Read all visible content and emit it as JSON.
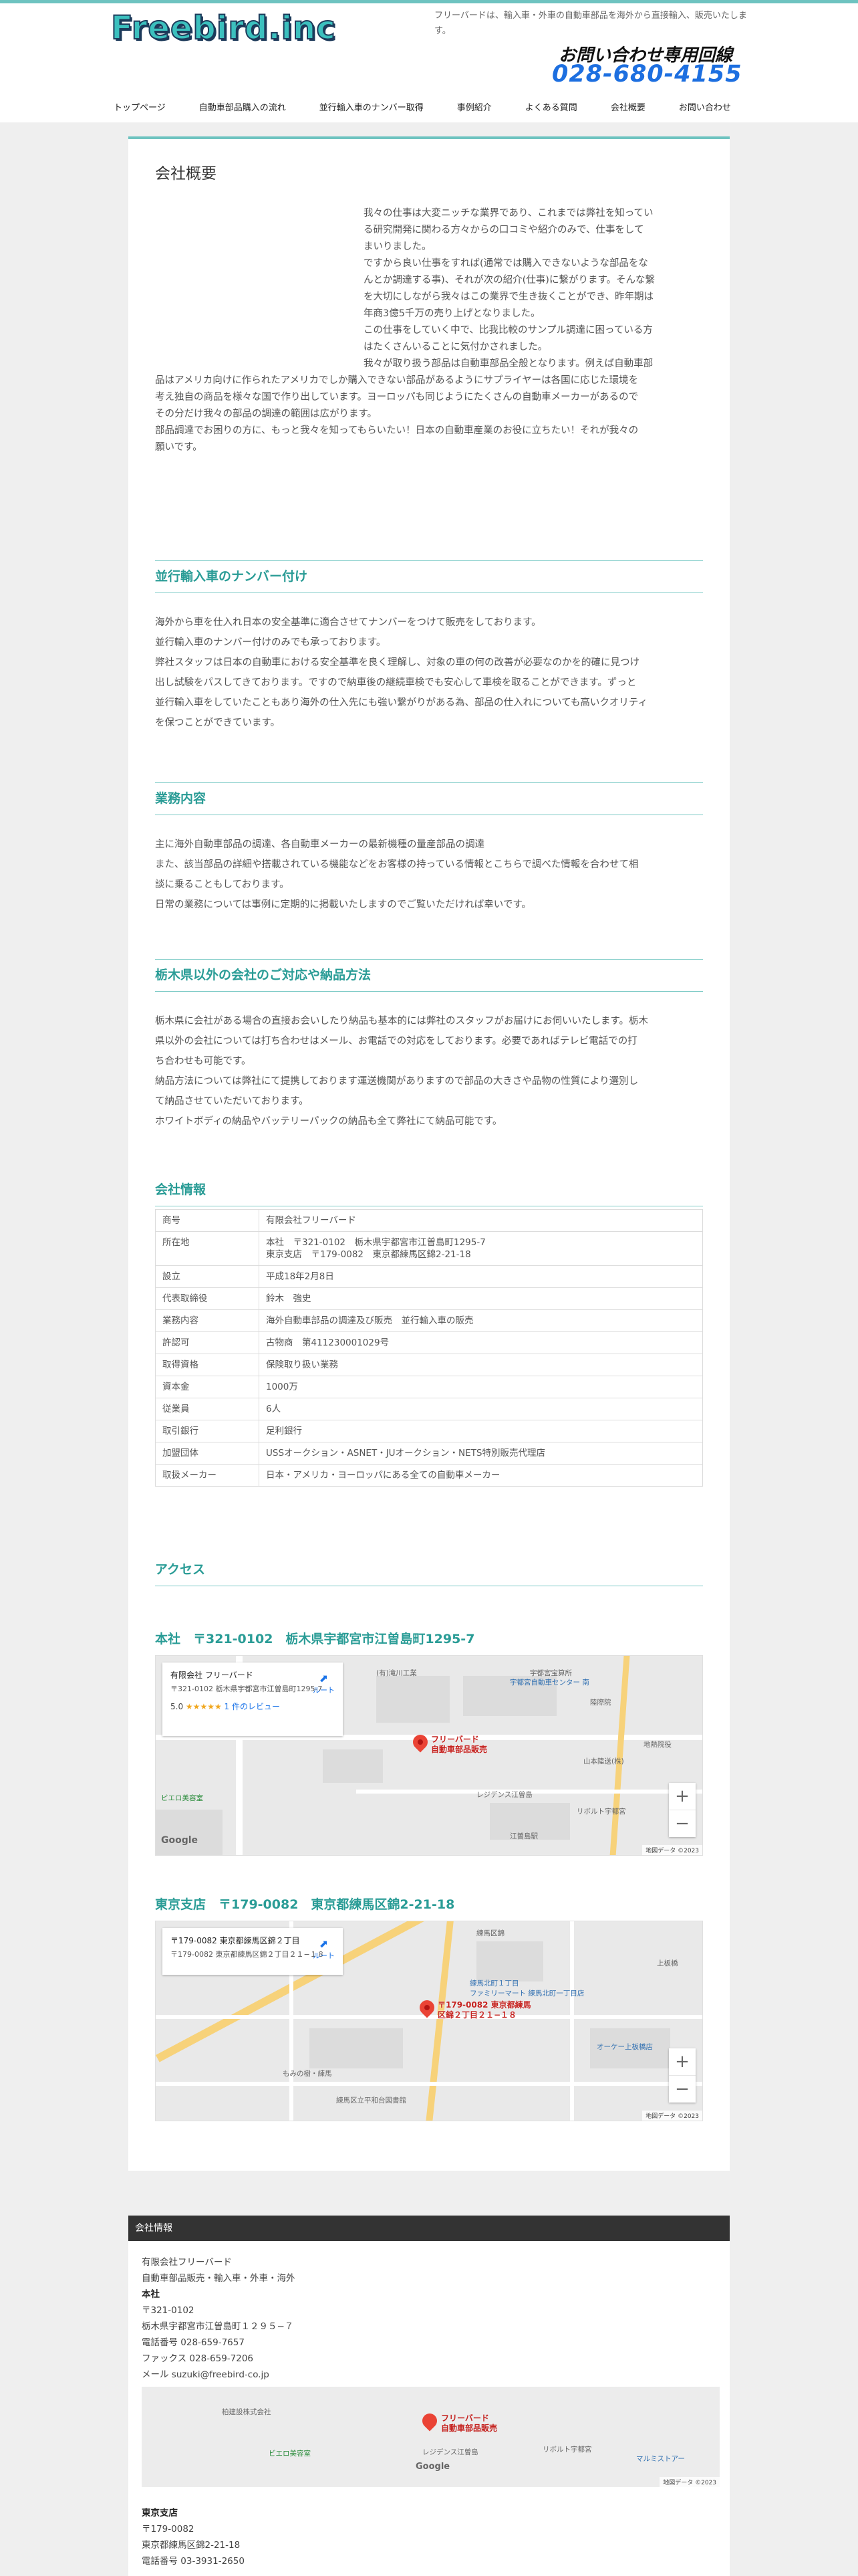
{
  "header": {
    "logo": "Freebird.inc",
    "tagline": "フリーバードは、輸入車・外車の自動車部品を海外から直接輸入、販売いたします。",
    "contact_label": "お問い合わせ専用回線",
    "contact_phone": "028-680-4155"
  },
  "nav": [
    {
      "label": "トップページ"
    },
    {
      "label": "自動車部品購入の流れ"
    },
    {
      "label": "並行輸入車のナンバー取得"
    },
    {
      "label": "事例紹介"
    },
    {
      "label": "よくある質問"
    },
    {
      "label": "会社概要"
    },
    {
      "label": "お問い合わせ"
    }
  ],
  "page": {
    "title": "会社概要",
    "intro_lines": [
      "我々の仕事は大変ニッチな業界であり、これまでは弊社を知ってい",
      "る研究開発に関わる方々からの口コミや紹介のみで、仕事をして",
      "まいりました。",
      "ですから良い仕事をすれば(通常では購入できないような部品をな",
      "んとか調達する事)、それが次の紹介(仕事)に繋がります。そんな繋",
      "を大切にしながら我々はこの業界で生き抜くことができ、昨年期は",
      "年商3億5千万の売り上げとなりました。",
      "この仕事をしていく中で、比我比較のサンプル調達に困っている方",
      "はたくさんいることに気付かされました。",
      "我々が取り扱う部品は自動車部品全般となります。例えば自動車部",
      "品はアメリカ向けに作られたアメリカでしか購入できない部品があるようにサプライヤーは各国に応じた環境を",
      "考え独自の商品を様々な国で作り出しています。ヨーロッパも同じようにたくさんの自動車メーカーがあるので",
      "その分だけ我々の部品の調達の範囲は広がります。",
      "部品調達でお困りの方に、もっと我々を知ってもらいたい！日本の自動車産業のお役に立ちたい！それが我々の",
      "願いです。"
    ]
  },
  "sections": {
    "number": {
      "title": "並行輸入車のナンバー付け",
      "lines": [
        "海外から車を仕入れ日本の安全基準に適合させてナンバーをつけて販売をしております。",
        "並行輸入車のナンバー付けのみでも承っております。",
        "弊社スタッフは日本の自動車における安全基準を良く理解し、対象の車の何の改善が必要なのかを的確に見つけ",
        "出し試験をパスしてきております。ですので納車後の継続車検でも安心して車検を取ることができます。ずっと",
        "並行輸入車をしていたこともあり海外の仕入先にも強い繋がりがある為、部品の仕入れについても高いクオリティ",
        "を保つことができています。"
      ]
    },
    "business": {
      "title": "業務内容",
      "lines": [
        "主に海外自動車部品の調達、各自動車メーカーの最新機種の量産部品の調達",
        "また、該当部品の詳細や搭載されている機能などをお客様の持っている情報とこちらで調べた情報を合わせて相",
        "談に乗ることもしております。",
        "日常の業務については事例に定期的に掲載いたしますのでご覧いただければ幸いです。"
      ]
    },
    "outside": {
      "title": "栃木県以外の会社のご対応や納品方法",
      "lines": [
        "栃木県に会社がある場合の直接お会いしたり納品も基本的には弊社のスタッフがお届けにお伺いいたします。栃木",
        "県以外の会社については打ち合わせはメール、お電話での対応をしております。必要であればテレビ電話での打",
        "ち合わせも可能です。",
        "納品方法については弊社にて提携しております運送機関がありますので部品の大きさや品物の性質により選別し",
        "て納品させていただいております。",
        "ホワイトボディの納品やバッテリーパックの納品も全て弊社にて納品可能です。"
      ]
    },
    "company_info": {
      "title": "会社情報",
      "rows": [
        {
          "k": "商号",
          "v": [
            "有限会社フリーバード"
          ]
        },
        {
          "k": "所在地",
          "v": [
            "本社　〒321-0102　栃木県宇都宮市江曽島町1295-7",
            "東京支店　〒179-0082　東京都練馬区錦2-21-18"
          ]
        },
        {
          "k": "設立",
          "v": [
            "平成18年2月8日"
          ]
        },
        {
          "k": "代表取締役",
          "v": [
            "鈴木　強史"
          ]
        },
        {
          "k": "業務内容",
          "v": [
            "海外自動車部品の調達及び販売　並行輸入車の販売"
          ]
        },
        {
          "k": "許認可",
          "v": [
            "古物商　第411230001029号"
          ]
        },
        {
          "k": "取得資格",
          "v": [
            "保険取り扱い業務"
          ]
        },
        {
          "k": "資本金",
          "v": [
            "1000万"
          ]
        },
        {
          "k": "従業員",
          "v": [
            "6人"
          ]
        },
        {
          "k": "取引銀行",
          "v": [
            "足利銀行"
          ]
        },
        {
          "k": "加盟団体",
          "v": [
            "USSオークション・ASNET・JUオークション・NETS特別販売代理店"
          ]
        },
        {
          "k": "取扱メーカー",
          "v": [
            "日本・アメリカ・ヨーロッパにある全ての自動車メーカー"
          ]
        }
      ]
    },
    "access": {
      "title": "アクセス",
      "honsha_heading": "本社　〒321-0102　栃木県宇都宮市江曽島町1295-7",
      "tokyo_heading": "東京支店　〒179-0082　東京都練馬区錦2-21-18",
      "map1": {
        "card_title": "有限会社 フリーバード",
        "card_address": "〒321-0102 栃木県宇都宮市江曽島町1295-7",
        "rating": "5.0",
        "stars": "★★★★★",
        "reviews": "1 件のレビュー",
        "directions": "ルート",
        "pin_label_1": "フリーバード",
        "pin_label_2": "自動車部品販売",
        "labels": [
          "(有)滝川工業",
          "宇都宮宝算所",
          "宇都宮自動車センター 南",
          "山本陸送(株)",
          "陸際院",
          "地熱院役",
          "レジデンス江曽島",
          "リボルト宇都宮",
          "江曽島駅",
          "ビエロ美容室",
          "Google",
          "地図データ ©2023"
        ]
      },
      "map2": {
        "card_title": "〒179-0082 東京都練馬区錦２丁目",
        "card_address": "〒179-0082 東京都練馬区錦２丁目２１−１８",
        "directions": "ルート",
        "pin_label_1": "〒179-0082 東京都練馬",
        "pin_label_2": "区錦２丁目２１−１８",
        "labels": [
          "練馬北町１丁目",
          "上板橋",
          "オーケー上板橋店",
          "ファミリーマート 練馬北町一丁目店",
          "もみの樹・練馬",
          "練馬区立平和台図書館",
          "練馬区錦",
          "地図データ ©2023"
        ]
      }
    }
  },
  "footer": {
    "bar_title": "会社情報",
    "lines": [
      "有限会社フリーバード",
      "自動車部品販売・輸入車・外車・海外",
      "本社",
      "〒321-0102",
      "栃木県宇都宮市江曽島町１２９５−７",
      "電話番号 028-659-7657",
      "ファックス 028-659-7206",
      "メール suzuki@freebird-co.jp"
    ],
    "map_pin_1": "フリーバード",
    "map_pin_2": "自動車部品販売",
    "map_labels": [
      "柏建設株式会社",
      "ビエロ美容室",
      "レジデンス江曽島",
      "リボルト宇都宮",
      "マルミストアー",
      "Google",
      "地図データ ©2023"
    ],
    "branch_lines": [
      "東京支店",
      "〒179-0082",
      "東京都練馬区錦2-21-18",
      "電話番号 03-3931-2650"
    ]
  },
  "colors": {
    "accent": "#2a9c96",
    "accent_line": "#7ccac6",
    "phone": "#1d6fe0",
    "footer_bar": "#333333"
  }
}
